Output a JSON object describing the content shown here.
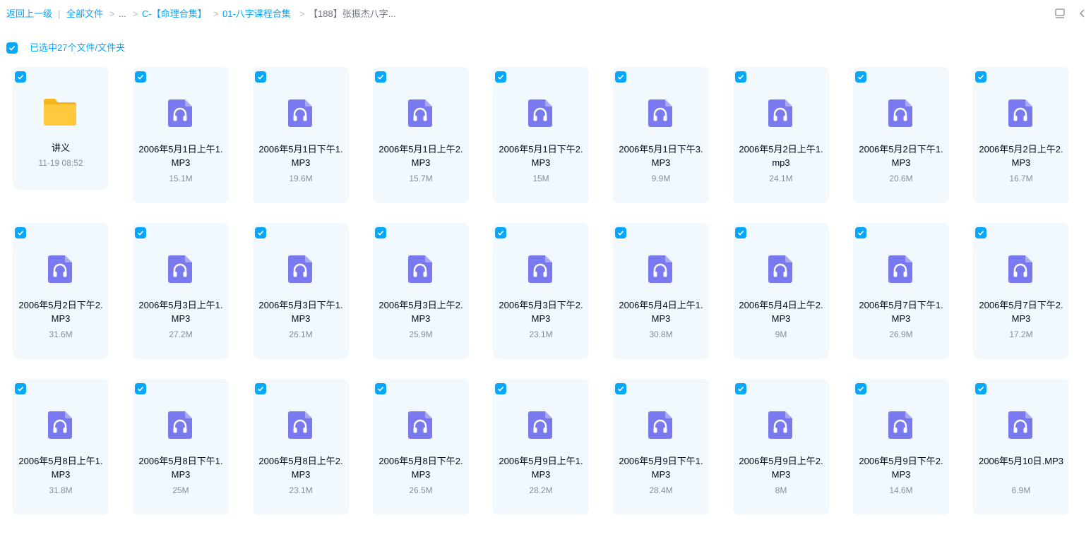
{
  "breadcrumb": {
    "back": "返回上一级",
    "root": "全部文件",
    "ellipsis": "...",
    "level1": "C-【命理合集】",
    "level2": "01-八字课程合集",
    "current": "【188】张振杰八字..."
  },
  "selection": {
    "text": "已选中27个文件/文件夹"
  },
  "colors": {
    "accent": "#06a7ff",
    "card_bg": "#f1f9fe",
    "audio_icon": "#7b79f0",
    "folder_icon": "#ffc83d"
  },
  "files": [
    {
      "type": "folder",
      "name": "讲义",
      "meta": "11-19 08:52"
    },
    {
      "type": "audio",
      "name": "2006年5月1日上午1.MP3",
      "meta": "15.1M"
    },
    {
      "type": "audio",
      "name": "2006年5月1日下午1.MP3",
      "meta": "19.6M"
    },
    {
      "type": "audio",
      "name": "2006年5月1日上午2.MP3",
      "meta": "15.7M"
    },
    {
      "type": "audio",
      "name": "2006年5月1日下午2.MP3",
      "meta": "15M"
    },
    {
      "type": "audio",
      "name": "2006年5月1日下午3.MP3",
      "meta": "9.9M"
    },
    {
      "type": "audio",
      "name": "2006年5月2日上午1.mp3",
      "meta": "24.1M"
    },
    {
      "type": "audio",
      "name": "2006年5月2日下午1.MP3",
      "meta": "20.6M"
    },
    {
      "type": "audio",
      "name": "2006年5月2日上午2.MP3",
      "meta": "16.7M"
    },
    {
      "type": "audio",
      "name": "2006年5月2日下午2.MP3",
      "meta": "31.6M"
    },
    {
      "type": "audio",
      "name": "2006年5月3日上午1.MP3",
      "meta": "27.2M"
    },
    {
      "type": "audio",
      "name": "2006年5月3日下午1.MP3",
      "meta": "26.1M"
    },
    {
      "type": "audio",
      "name": "2006年5月3日上午2.MP3",
      "meta": "25.9M"
    },
    {
      "type": "audio",
      "name": "2006年5月3日下午2.MP3",
      "meta": "23.1M"
    },
    {
      "type": "audio",
      "name": "2006年5月4日上午1.MP3",
      "meta": "30.8M"
    },
    {
      "type": "audio",
      "name": "2006年5月4日上午2.MP3",
      "meta": "9M"
    },
    {
      "type": "audio",
      "name": "2006年5月7日下午1.MP3",
      "meta": "26.9M"
    },
    {
      "type": "audio",
      "name": "2006年5月7日下午2.MP3",
      "meta": "17.2M"
    },
    {
      "type": "audio",
      "name": "2006年5月8日上午1.MP3",
      "meta": "31.8M"
    },
    {
      "type": "audio",
      "name": "2006年5月8日下午1.MP3",
      "meta": "25M"
    },
    {
      "type": "audio",
      "name": "2006年5月8日上午2.MP3",
      "meta": "23.1M"
    },
    {
      "type": "audio",
      "name": "2006年5月8日下午2.MP3",
      "meta": "26.5M"
    },
    {
      "type": "audio",
      "name": "2006年5月9日上午1.MP3",
      "meta": "28.2M"
    },
    {
      "type": "audio",
      "name": "2006年5月9日下午1.MP3",
      "meta": "28.4M"
    },
    {
      "type": "audio",
      "name": "2006年5月9日上午2.MP3",
      "meta": "8M"
    },
    {
      "type": "audio",
      "name": "2006年5月9日下午2.MP3",
      "meta": "14.6M"
    },
    {
      "type": "audio",
      "name": "2006年5月10日.MP3",
      "meta": "6.9M"
    }
  ]
}
